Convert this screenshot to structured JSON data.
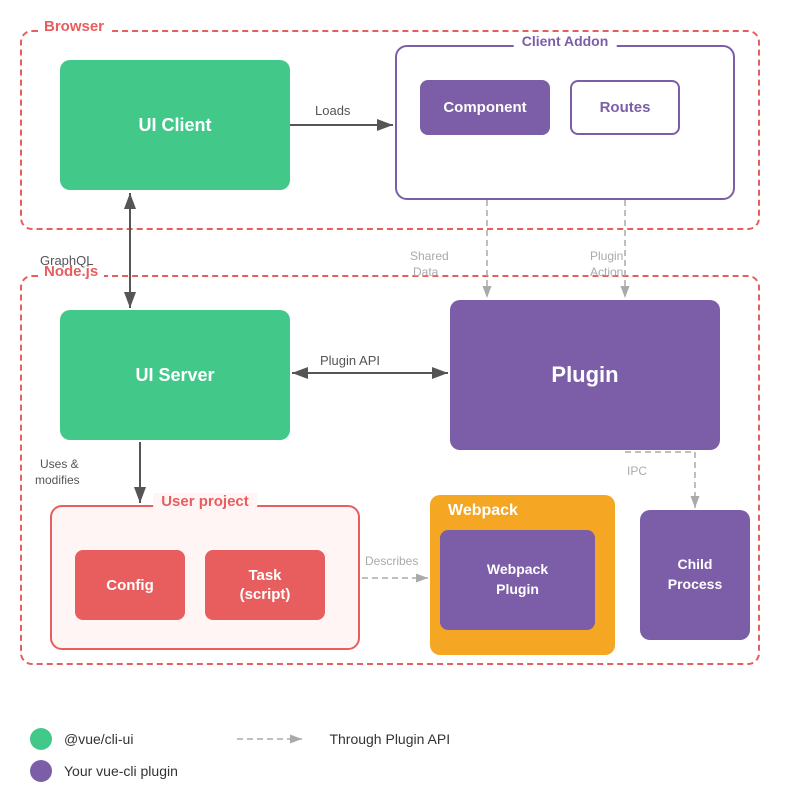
{
  "diagram": {
    "browser_label": "Browser",
    "nodejs_label": "Node.js",
    "ui_client": "UI Client",
    "client_addon_label": "Client Addon",
    "component": "Component",
    "routes": "Routes",
    "loads_label": "Loads",
    "graphql_label": "GraphQL",
    "shared_data_label": "Shared Data",
    "plugin_action_label": "Plugin Action",
    "ui_server": "UI Server",
    "plugin": "Plugin",
    "plugin_api_label": "Plugin API",
    "user_project_label": "User project",
    "config": "Config",
    "task": "Task\n(script)",
    "uses_modifies_label": "Uses &\nmodifies",
    "describes_label": "Describes",
    "ipc_label": "IPC",
    "webpack_label": "Webpack",
    "webpack_plugin": "Webpack\nPlugin",
    "child_process": "Child\nProcess",
    "legend_green_label": "@vue/cli-ui",
    "legend_purple_label": "Your vue-cli plugin",
    "legend_dashed_label": "Through Plugin API",
    "colors": {
      "green": "#42c98a",
      "purple": "#7b5ea7",
      "red": "#e85d5d",
      "orange": "#f5a623",
      "white": "#ffffff"
    }
  }
}
